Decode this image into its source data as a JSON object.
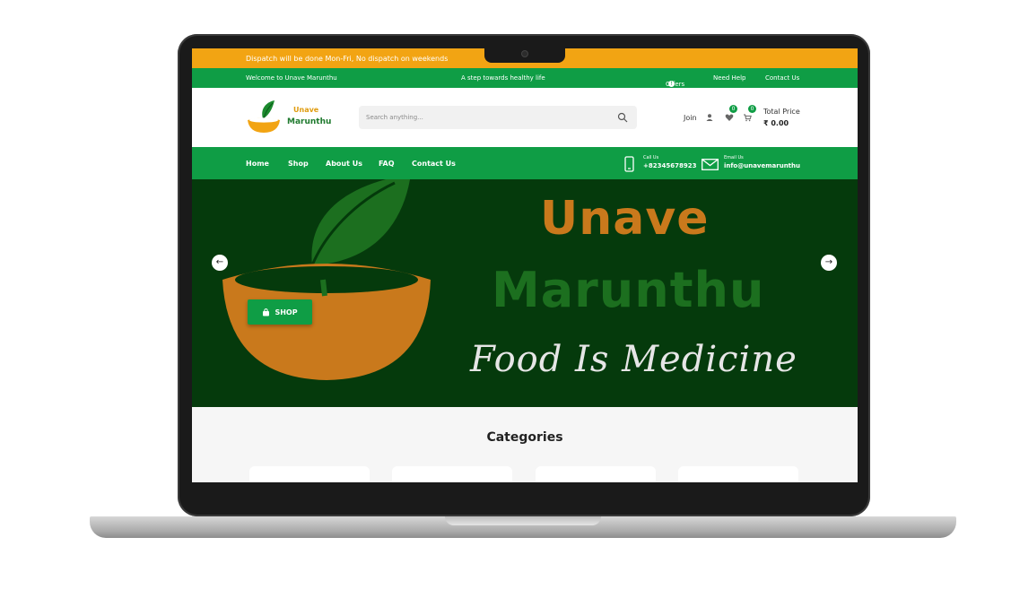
{
  "top_bar": {
    "dispatch_notice": "Dispatch will be done Mon-Fri, No dispatch on weekends"
  },
  "info_bar": {
    "welcome": "Welcome to Unave Marunthu",
    "slogan": "A step towards healthy life",
    "offers": "Offers",
    "need_help": "Need Help",
    "contact_us": "Contact Us"
  },
  "header": {
    "logo_line1": "Unave",
    "logo_line2": "Marunthu",
    "search_placeholder": "Search anything...",
    "join": "Join",
    "wishlist_count": "0",
    "cart_count": "0",
    "total_price_label": "Total Price",
    "total_price_value": "₹ 0.00"
  },
  "nav": {
    "items": [
      "Home",
      "Shop",
      "About Us",
      "FAQ",
      "Contact Us"
    ],
    "call_label": "Call Us",
    "call_number": "+82345678923",
    "email_label": "Email Us",
    "email_address": "info@unavemarunthu"
  },
  "hero": {
    "title_line1": "Unave",
    "title_line2": "Marunthu",
    "tagline": "Food Is Medicine",
    "shop_button": "SHOP"
  },
  "categories": {
    "title": "Categories"
  },
  "colors": {
    "orange": "#f2a413",
    "green": "#0f9d45",
    "hero_bg": "#053a0c",
    "bowl": "#c9791c",
    "leaf": "#1c6f1f"
  }
}
